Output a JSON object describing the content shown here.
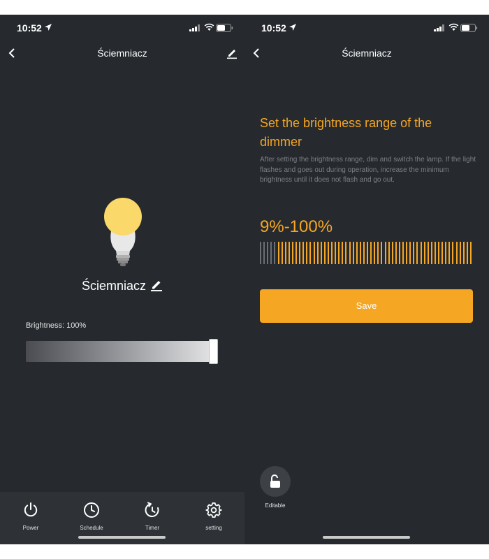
{
  "status_bar": {
    "time": "10:52"
  },
  "left_screen": {
    "nav": {
      "title": "Ściemniacz"
    },
    "device": {
      "name": "Ściemniacz"
    },
    "brightness": {
      "label": "Brightness: 100%",
      "value_percent": 100
    },
    "tabs": [
      {
        "label": "Power",
        "icon": "power-icon"
      },
      {
        "label": "Schedule",
        "icon": "clock-icon"
      },
      {
        "label": "Timer",
        "icon": "timer-icon"
      },
      {
        "label": "setting",
        "icon": "gear-icon"
      }
    ]
  },
  "right_screen": {
    "nav": {
      "title": "Ściemniacz"
    },
    "heading": "Set the brightness range of the dimmer",
    "description": "After setting the brightness range, dim and switch the lamp. If the light flashes and goes out during operation, increase the minimum brightness until it does not flash and go out.",
    "range": {
      "text": "9%-100%",
      "min_percent": 9,
      "max_percent": 100
    },
    "save_label": "Save",
    "lock": {
      "label": "Editable",
      "icon": "unlock-icon"
    }
  },
  "colors": {
    "background": "#262a2e",
    "tab_bar": "#2e3236",
    "accent": "#f5a623",
    "inactive_tick": "#6b6f76",
    "bulb_glow": "#fbd86a"
  }
}
